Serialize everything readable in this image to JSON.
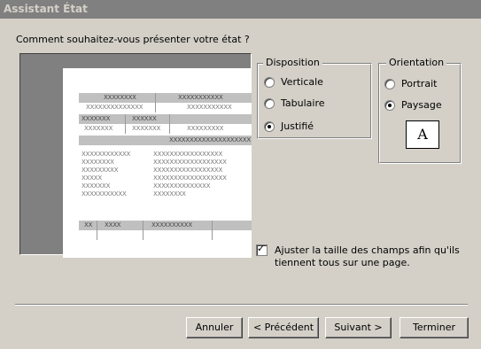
{
  "window": {
    "title": "Assistant État"
  },
  "prompt": "Comment souhaitez-vous présenter votre état ?",
  "preview": {
    "header": [
      "XXXXXXXX",
      "XXXXXXXXXXX",
      "XXXXXXXXXXXXXX",
      "XXXXXXXXXXX"
    ],
    "row2": [
      "XXXXXXX",
      "XXXXXX"
    ],
    "row2sub": [
      "XXXXXXX",
      "XXXXXXX",
      "XXXXXXXXX"
    ],
    "bar2": "XXXXXXXXXXXXXXXXXXXX",
    "left_lines": [
      "XXXXXXXXXXXX",
      "XXXXXXXX",
      "XXXXXXXXX",
      "XXXXX",
      "XXXXXXX",
      "XXXXXXXXXXX"
    ],
    "right_lines": [
      "XXXXXXXXXXXXXXXXX",
      "XXXXXXXXXXXXXXXXXX",
      "XXXXXXXXXXXXXXXXX",
      "XXXXXXXXXXXXXXXXXX",
      "XXXXXXXXXXXXXX",
      "XXXXXXXX"
    ],
    "footer": [
      "XX",
      "XXXX",
      "XXXXXXXXXX"
    ]
  },
  "disposition": {
    "legend": "Disposition",
    "options": [
      {
        "label": "Verticale",
        "checked": false
      },
      {
        "label": "Tabulaire",
        "checked": false
      },
      {
        "label": "Justifié",
        "checked": true
      }
    ]
  },
  "orientation": {
    "legend": "Orientation",
    "options": [
      {
        "label": "Portrait",
        "checked": false
      },
      {
        "label": "Paysage",
        "checked": true
      }
    ],
    "icon_letter": "A"
  },
  "adjust": {
    "checked": true,
    "line1": "Ajuster la taille des champs afin qu'ils",
    "line2": "tiennent tous sur une page."
  },
  "buttons": {
    "cancel": "Annuler",
    "previous": "< Précédent",
    "next": "Suivant >",
    "finish": "Terminer"
  }
}
